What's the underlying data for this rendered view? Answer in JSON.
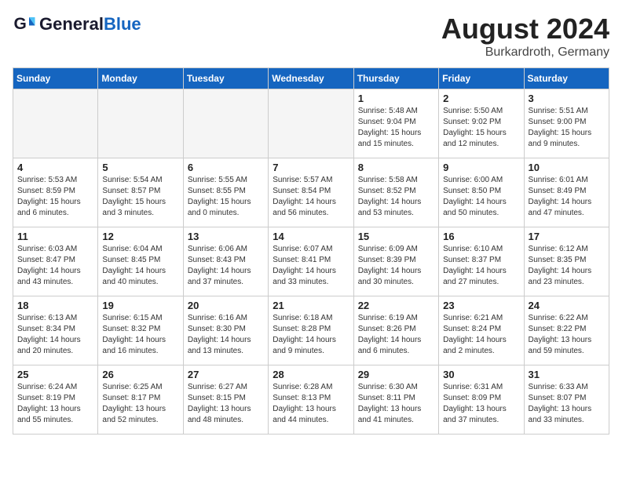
{
  "header": {
    "logo_general": "General",
    "logo_blue": "Blue",
    "month": "August 2024",
    "location": "Burkardroth, Germany"
  },
  "weekdays": [
    "Sunday",
    "Monday",
    "Tuesday",
    "Wednesday",
    "Thursday",
    "Friday",
    "Saturday"
  ],
  "weeks": [
    [
      {
        "day": "",
        "empty": true
      },
      {
        "day": "",
        "empty": true
      },
      {
        "day": "",
        "empty": true
      },
      {
        "day": "",
        "empty": true
      },
      {
        "day": "1",
        "sunrise": "5:48 AM",
        "sunset": "9:04 PM",
        "daylight": "15 hours and 15 minutes."
      },
      {
        "day": "2",
        "sunrise": "5:50 AM",
        "sunset": "9:02 PM",
        "daylight": "15 hours and 12 minutes."
      },
      {
        "day": "3",
        "sunrise": "5:51 AM",
        "sunset": "9:00 PM",
        "daylight": "15 hours and 9 minutes."
      }
    ],
    [
      {
        "day": "4",
        "sunrise": "5:53 AM",
        "sunset": "8:59 PM",
        "daylight": "15 hours and 6 minutes."
      },
      {
        "day": "5",
        "sunrise": "5:54 AM",
        "sunset": "8:57 PM",
        "daylight": "15 hours and 3 minutes."
      },
      {
        "day": "6",
        "sunrise": "5:55 AM",
        "sunset": "8:55 PM",
        "daylight": "15 hours and 0 minutes."
      },
      {
        "day": "7",
        "sunrise": "5:57 AM",
        "sunset": "8:54 PM",
        "daylight": "14 hours and 56 minutes."
      },
      {
        "day": "8",
        "sunrise": "5:58 AM",
        "sunset": "8:52 PM",
        "daylight": "14 hours and 53 minutes."
      },
      {
        "day": "9",
        "sunrise": "6:00 AM",
        "sunset": "8:50 PM",
        "daylight": "14 hours and 50 minutes."
      },
      {
        "day": "10",
        "sunrise": "6:01 AM",
        "sunset": "8:49 PM",
        "daylight": "14 hours and 47 minutes."
      }
    ],
    [
      {
        "day": "11",
        "sunrise": "6:03 AM",
        "sunset": "8:47 PM",
        "daylight": "14 hours and 43 minutes."
      },
      {
        "day": "12",
        "sunrise": "6:04 AM",
        "sunset": "8:45 PM",
        "daylight": "14 hours and 40 minutes."
      },
      {
        "day": "13",
        "sunrise": "6:06 AM",
        "sunset": "8:43 PM",
        "daylight": "14 hours and 37 minutes."
      },
      {
        "day": "14",
        "sunrise": "6:07 AM",
        "sunset": "8:41 PM",
        "daylight": "14 hours and 33 minutes."
      },
      {
        "day": "15",
        "sunrise": "6:09 AM",
        "sunset": "8:39 PM",
        "daylight": "14 hours and 30 minutes."
      },
      {
        "day": "16",
        "sunrise": "6:10 AM",
        "sunset": "8:37 PM",
        "daylight": "14 hours and 27 minutes."
      },
      {
        "day": "17",
        "sunrise": "6:12 AM",
        "sunset": "8:35 PM",
        "daylight": "14 hours and 23 minutes."
      }
    ],
    [
      {
        "day": "18",
        "sunrise": "6:13 AM",
        "sunset": "8:34 PM",
        "daylight": "14 hours and 20 minutes."
      },
      {
        "day": "19",
        "sunrise": "6:15 AM",
        "sunset": "8:32 PM",
        "daylight": "14 hours and 16 minutes."
      },
      {
        "day": "20",
        "sunrise": "6:16 AM",
        "sunset": "8:30 PM",
        "daylight": "14 hours and 13 minutes."
      },
      {
        "day": "21",
        "sunrise": "6:18 AM",
        "sunset": "8:28 PM",
        "daylight": "14 hours and 9 minutes."
      },
      {
        "day": "22",
        "sunrise": "6:19 AM",
        "sunset": "8:26 PM",
        "daylight": "14 hours and 6 minutes."
      },
      {
        "day": "23",
        "sunrise": "6:21 AM",
        "sunset": "8:24 PM",
        "daylight": "14 hours and 2 minutes."
      },
      {
        "day": "24",
        "sunrise": "6:22 AM",
        "sunset": "8:22 PM",
        "daylight": "13 hours and 59 minutes."
      }
    ],
    [
      {
        "day": "25",
        "sunrise": "6:24 AM",
        "sunset": "8:19 PM",
        "daylight": "13 hours and 55 minutes."
      },
      {
        "day": "26",
        "sunrise": "6:25 AM",
        "sunset": "8:17 PM",
        "daylight": "13 hours and 52 minutes."
      },
      {
        "day": "27",
        "sunrise": "6:27 AM",
        "sunset": "8:15 PM",
        "daylight": "13 hours and 48 minutes."
      },
      {
        "day": "28",
        "sunrise": "6:28 AM",
        "sunset": "8:13 PM",
        "daylight": "13 hours and 44 minutes."
      },
      {
        "day": "29",
        "sunrise": "6:30 AM",
        "sunset": "8:11 PM",
        "daylight": "13 hours and 41 minutes."
      },
      {
        "day": "30",
        "sunrise": "6:31 AM",
        "sunset": "8:09 PM",
        "daylight": "13 hours and 37 minutes."
      },
      {
        "day": "31",
        "sunrise": "6:33 AM",
        "sunset": "8:07 PM",
        "daylight": "13 hours and 33 minutes."
      }
    ]
  ]
}
